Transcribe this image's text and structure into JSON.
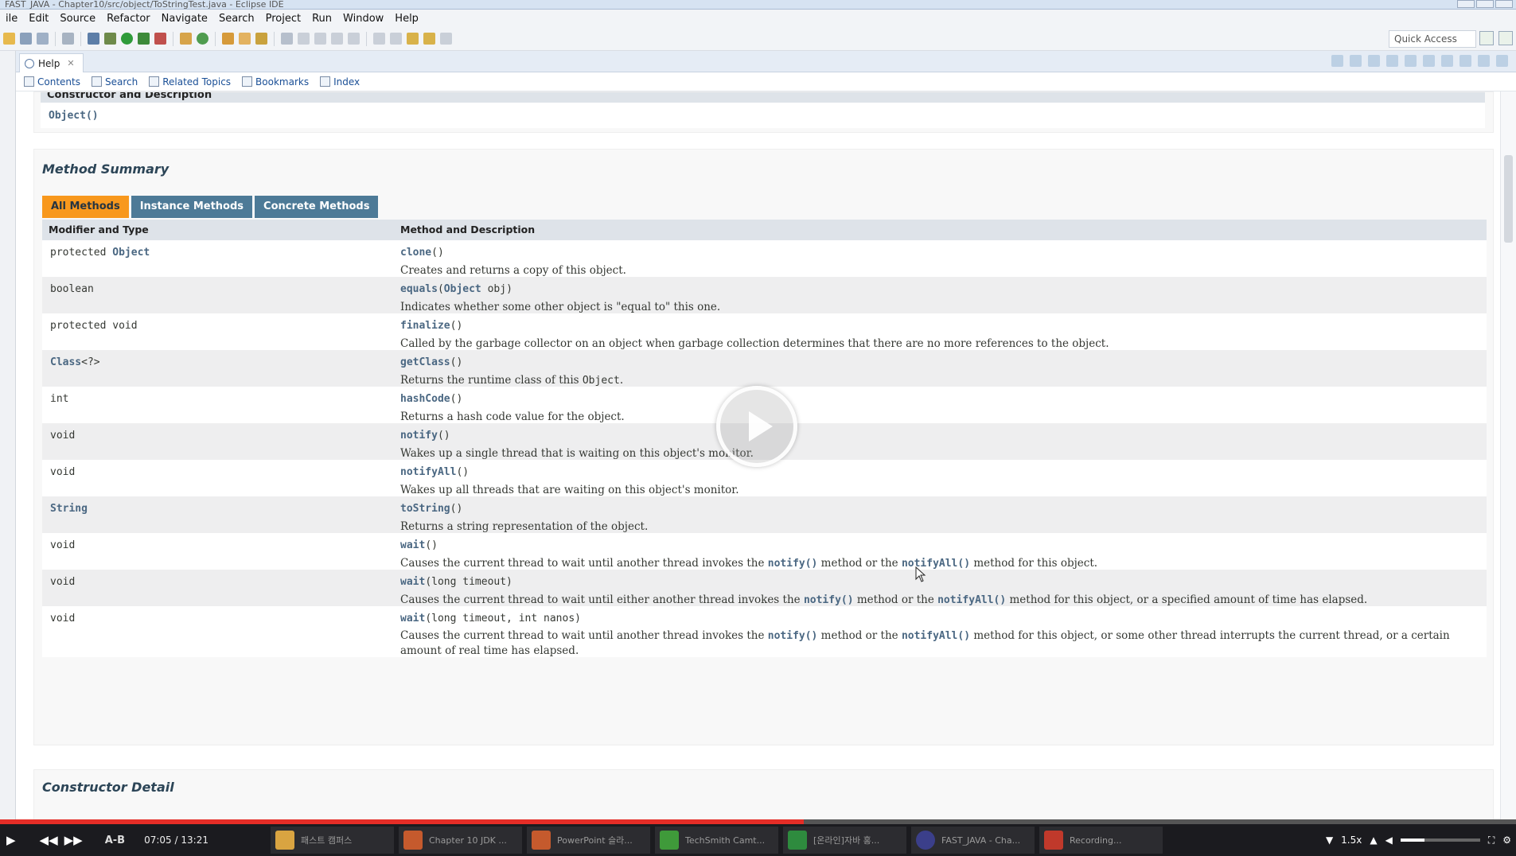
{
  "window": {
    "title": "FAST_JAVA - Chapter10/src/object/ToStringTest.java - Eclipse IDE"
  },
  "menu": [
    "ile",
    "Edit",
    "Source",
    "Refactor",
    "Navigate",
    "Search",
    "Project",
    "Run",
    "Window",
    "Help"
  ],
  "toolbar": {
    "quick_access": "Quick Access"
  },
  "help_view": {
    "tab_label": "Help",
    "nav": {
      "contents": "Contents",
      "search": "Search",
      "related_topics": "Related Topics",
      "bookmarks": "Bookmarks",
      "index": "Index"
    }
  },
  "constructor_summary": {
    "header": "Constructor and Description",
    "row": "Object()"
  },
  "method_summary": {
    "title": "Method Summary",
    "tabs": [
      "All Methods",
      "Instance Methods",
      "Concrete Methods"
    ],
    "columns": [
      "Modifier and Type",
      "Method and Description"
    ],
    "rows": [
      {
        "modifier": "protected ",
        "type_link": "Object",
        "name": "clone",
        "params": "()",
        "desc": "Creates and returns a copy of this object."
      },
      {
        "modifier": "boolean",
        "type_link": "",
        "name": "equals",
        "params_link": "Object",
        "params": " obj)",
        "desc": "Indicates whether some other object is \"equal to\" this one."
      },
      {
        "modifier": "protected void",
        "type_link": "",
        "name": "finalize",
        "params": "()",
        "desc": "Called by the garbage collector on an object when garbage collection determines that there are no more references to the object."
      },
      {
        "modifier": "",
        "type_link": "Class",
        "type_suffix": "<?>",
        "name": "getClass",
        "params": "()",
        "desc_pre": "Returns the runtime class of this ",
        "desc_code": "Object",
        "desc_post": "."
      },
      {
        "modifier": "int",
        "type_link": "",
        "name": "hashCode",
        "params": "()",
        "desc": "Returns a hash code value for the object."
      },
      {
        "modifier": "void",
        "type_link": "",
        "name": "notify",
        "params": "()",
        "desc": "Wakes up a single thread that is waiting on this object's monitor."
      },
      {
        "modifier": "void",
        "type_link": "",
        "name": "notifyAll",
        "params": "()",
        "desc": "Wakes up all threads that are waiting on this object's monitor."
      },
      {
        "modifier": "",
        "type_link": "String",
        "name": "toString",
        "params": "()",
        "desc": "Returns a string representation of the object."
      },
      {
        "modifier": "void",
        "type_link": "",
        "name": "wait",
        "params": "()",
        "desc_pre": "Causes the current thread to wait until another thread invokes the ",
        "link1": "notify()",
        "desc_mid": " method or the ",
        "link2": "notifyAll()",
        "desc_post": " method for this object."
      },
      {
        "modifier": "void",
        "type_link": "",
        "name": "wait",
        "params": "(long timeout)",
        "desc_pre": "Causes the current thread to wait until either another thread invokes the ",
        "link1": "notify()",
        "desc_mid": " method or the ",
        "link2": "notifyAll()",
        "desc_post": " method for this object, or a specified amount of time has elapsed."
      },
      {
        "modifier": "void",
        "type_link": "",
        "name": "wait",
        "params": "(long timeout, int nanos)",
        "desc_pre": "Causes the current thread to wait until another thread invokes the ",
        "link1": "notify()",
        "desc_mid": " method or the ",
        "link2": "notifyAll()",
        "desc_post": " method for this object, or some other thread interrupts the current thread, or a certain amount of real time has elapsed."
      }
    ]
  },
  "constructor_detail": {
    "title": "Constructor Detail"
  },
  "player": {
    "ab_label": "A-B",
    "current_time": "07:05",
    "separator": "/",
    "total_time": "13:21",
    "speed": "1.5x",
    "progress": 0.53,
    "tasks": [
      "패스트 캠퍼스",
      "Chapter 10 JDK ...",
      "PowerPoint 슬라...",
      "TechSmith Camt...",
      "[온라인]자바 홍...",
      "FAST_JAVA - Cha...",
      "Recording..."
    ]
  },
  "colors": {
    "tab_active": "#f8981d",
    "tab_inactive": "#4d7a97",
    "table_header": "#dee3e9",
    "link": "#4a6782",
    "progress": "#e52d27"
  }
}
